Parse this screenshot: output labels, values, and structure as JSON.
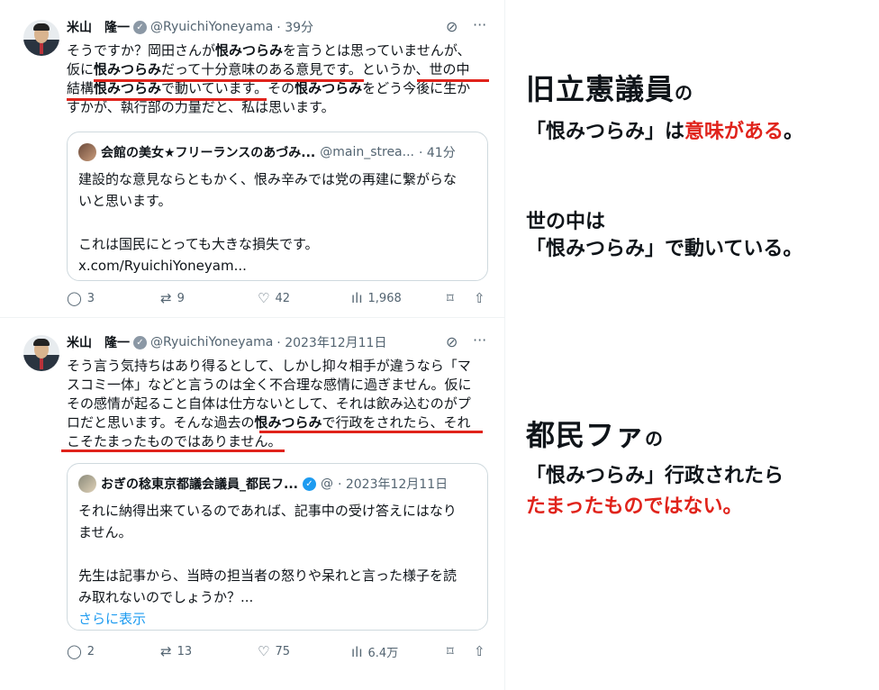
{
  "tweets": [
    {
      "name": "米山　隆一",
      "handle": "@RyuichiYoneyama",
      "time": "· 39分",
      "lines": [
        [
          "そうですか？岡田さんが",
          "恨みつらみ",
          "を言うとは思っていませんが、"
        ],
        [
          "仮に",
          "恨みつらみ",
          "だって十分意味のある意見です。というか、世の中"
        ],
        [
          "結構",
          "恨みつらみ",
          "で動いています。その",
          "恨みつらみ",
          "をどう今後に生か"
        ],
        [
          "すかが、執行部の力量だと、私は思います。"
        ]
      ],
      "quote": {
        "name": "会館の美女★フリーランスのあづみ...",
        "handle": "@main_strea...",
        "time": "· 41分",
        "lines": [
          "建設的な意見ならともかく、恨み辛みでは党の再建に繋がらな",
          "いと思います。",
          "",
          "これは国民にとっても大きな損失です。"
        ],
        "link": "x.com/RyuichiYoneyam..."
      },
      "stats": {
        "replies": "3",
        "retweets": "9",
        "likes": "42",
        "views": "1,968"
      }
    },
    {
      "name": "米山　隆一",
      "handle": "@RyuichiYoneyama",
      "time": "· 2023年12月11日",
      "lines": [
        [
          "そう言う気持ちはあり得るとして、しかし抑々相手が違うなら「マ"
        ],
        [
          "スコミ一体」などと言うのは全く不合理な感情に過ぎません。仮に"
        ],
        [
          "その感情が起ること自体は仕方ないとして、それは飲み込むのがプ"
        ],
        [
          "ロだと思います。そんな過去の",
          "恨みつらみ",
          "で行政をされたら、それ"
        ],
        [
          "こそたまったものではありません。"
        ]
      ],
      "quote": {
        "name": "おぎの稔東京都議会議員_都民フ...",
        "handle": "@",
        "time": "· 2023年12月11日",
        "lines": [
          "それに納得出来ているのであれば、記事中の受け答えにはなり",
          "ません。",
          "",
          "先生は記事から、当時の担当者の怒りや呆れと言った様子を読",
          "み取れないのでしょうか？..."
        ],
        "link": "さらに表示"
      },
      "stats": {
        "replies": "2",
        "retweets": "13",
        "likes": "75",
        "views": "6.4万"
      }
    }
  ],
  "captions": {
    "c1_title": "旧立憲議員",
    "c1_no": "の",
    "c1_line2_a": "「恨みつらみ」は",
    "c1_line2_b": "意味がある",
    "c1_line2_c": "。",
    "c2_line1": "世の中は",
    "c2_line2": "「恨みつらみ」で動いている。",
    "c3_title": "都民ファ",
    "c3_no": "の",
    "c3_line2": "「恨みつらみ」行政されたら",
    "c3_line3": "たまったものではない。"
  },
  "colors": {
    "accent": "#e0231b",
    "link": "#1d9bf0",
    "muted": "#536471"
  }
}
